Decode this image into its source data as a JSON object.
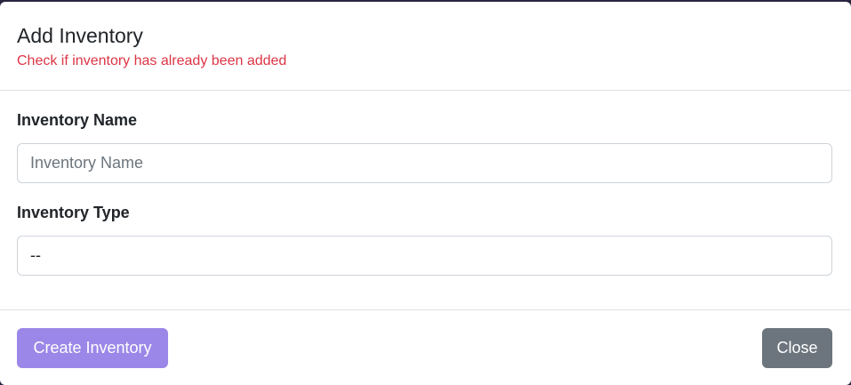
{
  "modal": {
    "title": "Add Inventory",
    "subtitle": "Check if inventory has already been added"
  },
  "form": {
    "name_label": "Inventory Name",
    "name_placeholder": "Inventory Name",
    "name_value": "",
    "type_label": "Inventory Type",
    "type_selected": "--"
  },
  "footer": {
    "create_label": "Create Inventory",
    "close_label": "Close"
  },
  "colors": {
    "subtitle": "#dc3545",
    "create_button": "#9b87e8",
    "close_button": "#6c757d"
  }
}
